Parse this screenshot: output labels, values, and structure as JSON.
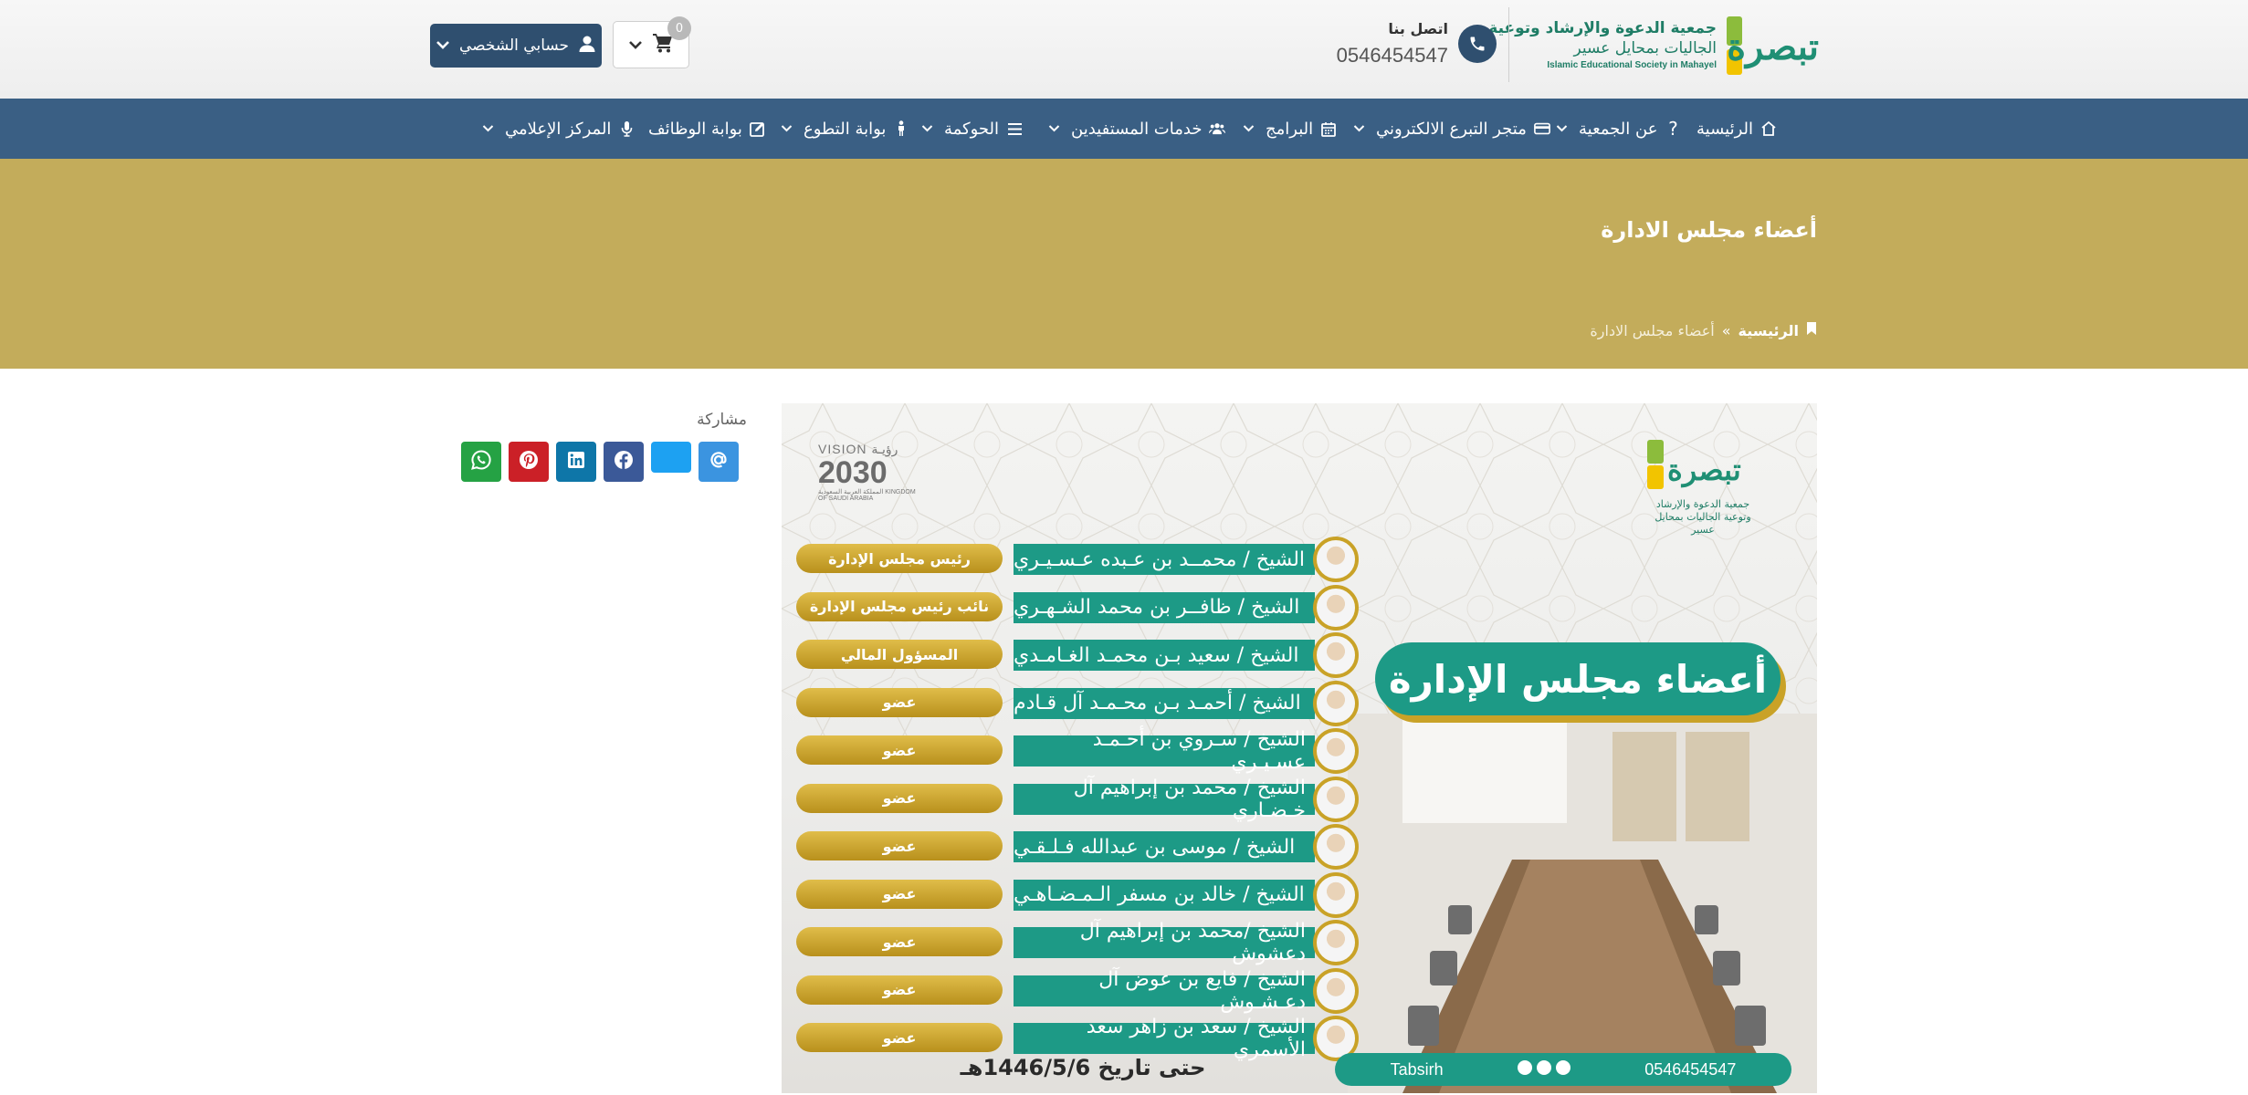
{
  "header": {
    "logo_word": "تبصرة",
    "logo_line1": "جمعية الدعوة والإرشاد وتوعية",
    "logo_line2": "الجاليات بمحايل عسير",
    "logo_line3": "Islamic Educational Society in Mahayel",
    "contact_title": "اتصل بنا",
    "contact_phone": "0546454547",
    "account_label": "حسابي الشخصي",
    "cart_count": "0"
  },
  "nav": {
    "items": [
      {
        "label": "الرئيسية",
        "icon": "home-icon"
      },
      {
        "label": "عن الجمعية",
        "icon": "question-icon"
      },
      {
        "label": "متجر التبرع الالكتروني",
        "icon": "credit-card-icon"
      },
      {
        "label": "البرامج",
        "icon": "calendar-icon"
      },
      {
        "label": "خدمات المستفيدين",
        "icon": "users-icon"
      },
      {
        "label": "الحوكمة",
        "icon": "list-icon"
      },
      {
        "label": "بوابة التطوع",
        "icon": "person-icon"
      },
      {
        "label": "بوابة الوظائف",
        "icon": "edit-icon"
      },
      {
        "label": "المركز الإعلامي",
        "icon": "microphone-icon"
      }
    ]
  },
  "page": {
    "title": "أعضاء مجلس الادارة",
    "breadcrumb_home": "الرئيسية",
    "breadcrumb_sep": "»",
    "breadcrumb_current": "أعضاء مجلس الادارة"
  },
  "share": {
    "label": "مشاركة",
    "buttons": [
      "email",
      "twitter",
      "facebook",
      "linkedin",
      "pinterest",
      "whatsapp"
    ]
  },
  "poster": {
    "logo_word": "تبصرة",
    "logo_sub": "جمعية الدعوة والإرشاد وتوعية الجاليات بمحايل عسير",
    "vision_top": "VISION رؤيـة",
    "vision_year": "2030",
    "vision_bottom": "المملكة العربية السعودية KINGDOM OF SAUDI ARABIA",
    "title": "أعضاء مجلس الإدارة",
    "members": [
      {
        "name": "الشيخ / محمــد بن عـبده عـسـيـري",
        "role": "رئيس مجلس الإدارة"
      },
      {
        "name": "الشيخ / ظافــر بن محمد الشـهـري",
        "role": "نائب رئيس مجلس الإدارة"
      },
      {
        "name": "الشيخ / سعيد بـن محمـد الغـامـدي",
        "role": "المسؤول المالي"
      },
      {
        "name": "الشيخ / أحمـد بـن محـمـد آل قـادم",
        "role": "عضو"
      },
      {
        "name": "الشيخ / سـروي بن أحـمـد عسـيـري",
        "role": "عضو"
      },
      {
        "name": "الشيخ / محمد بن إبراهيم آل خـضـاري",
        "role": "عضو"
      },
      {
        "name": "الشيخ / موسى بن عبدالله فـلـقـي",
        "role": "عضو"
      },
      {
        "name": "الشيخ / خالد بن مسفر الـمـضـاهـي",
        "role": "عضو"
      },
      {
        "name": "الشيخ /محمد بن إبراهيم آل دعشوش",
        "role": "عضو"
      },
      {
        "name": "الشيخ / فايع بن عوض آل دعـشـوش",
        "role": "عضو"
      },
      {
        "name": "الشيخ / سعد بن زاهر سعد الأسمري",
        "role": "عضو"
      }
    ],
    "date": "حتى تاريخ 1446/5/6هـ",
    "footer_phone": "0546454547",
    "footer_handle": "Tabsirh"
  },
  "colors": {
    "nav_bg": "#3a5f84",
    "band_bg": "#c3ac5b",
    "accent_teal": "#1d9a86",
    "accent_gold": "#c9a227"
  }
}
